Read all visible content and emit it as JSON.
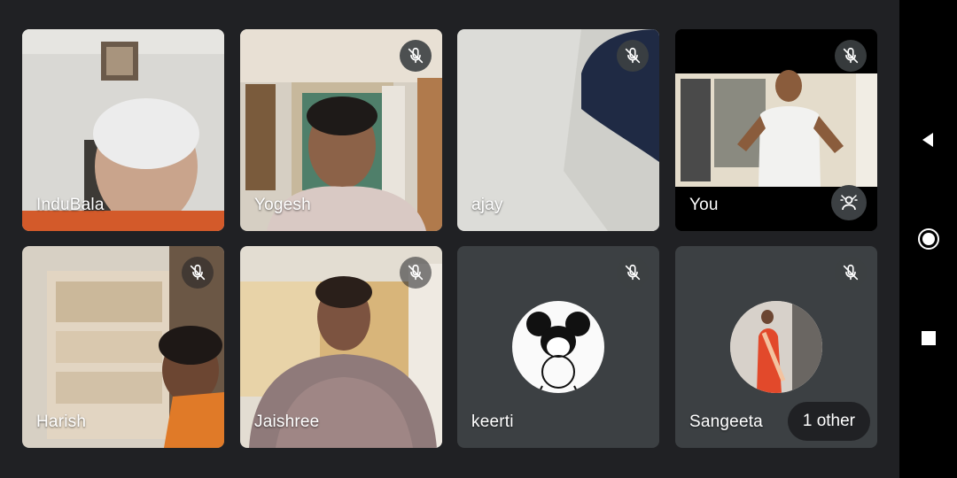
{
  "participants": [
    {
      "name": "InduBala",
      "muted": true
    },
    {
      "name": "Yogesh",
      "muted": true
    },
    {
      "name": "ajay",
      "muted": true
    },
    {
      "name": "You",
      "muted": true
    },
    {
      "name": "Harish",
      "muted": true
    },
    {
      "name": "Jaishree",
      "muted": true
    },
    {
      "name": "keerti",
      "muted": true
    },
    {
      "name": "Sangeeta",
      "muted": true
    }
  ],
  "others_pill": {
    "label": "1 other"
  },
  "icons": {
    "mic_off": "mic-off-icon",
    "effects": "visual-effects-icon",
    "back": "back-triangle-icon",
    "home": "home-circle-icon",
    "recents": "recents-square-icon"
  },
  "colors": {
    "background": "#202124",
    "tile": "#3c4043",
    "nav": "#000000"
  }
}
